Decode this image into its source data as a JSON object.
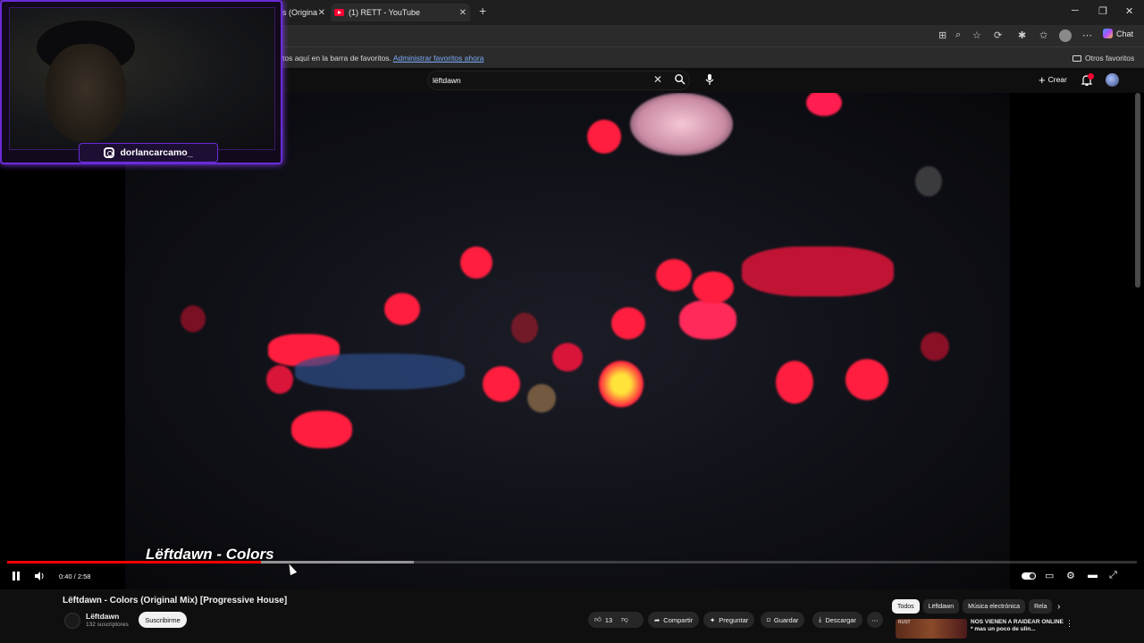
{
  "browser": {
    "tabs": [
      {
        "label": "s (Origina",
        "active": false
      },
      {
        "label": "(1) RETT - YouTube",
        "active": true
      }
    ],
    "new_tab": "+",
    "chat_label": "Chat",
    "favorites_text": "tos aquí en la barra de favoritos.",
    "favorites_link": "Administrar favoritos ahora",
    "other_favorites": "Otros favoritos"
  },
  "youtube": {
    "search_value": "lëftdawn",
    "create_label": "Crear",
    "notification_count": ""
  },
  "video": {
    "overlay_title": "Lëftdawn - Colors",
    "time": "0:40 / 2:58",
    "progress": 0.225,
    "buffered": 0.36,
    "title": "Lëftdawn - Colors (Original Mix) [Progressive House]",
    "channel_name": "Lëftdawn",
    "channel_subs": "132 suscriptores",
    "subscribe_label": "Suscribirme",
    "likes": "13",
    "share_label": "Compartir",
    "ask_label": "Preguntar",
    "save_label": "Guardar",
    "download_label": "Descargar"
  },
  "chips": [
    "Todos",
    "Lëftdawn",
    "Música electrónica",
    "Rela"
  ],
  "recommendation": {
    "title": "NOS VIENEN A  RAIDEAR ONLINE * mas un poco de ulin...",
    "thumb_text": "RUST"
  },
  "webcam": {
    "instagram_handle": "dorlancarcamo_"
  },
  "colors": {
    "accent": "#ff0000",
    "overlay_border": "#6a2bd9"
  }
}
